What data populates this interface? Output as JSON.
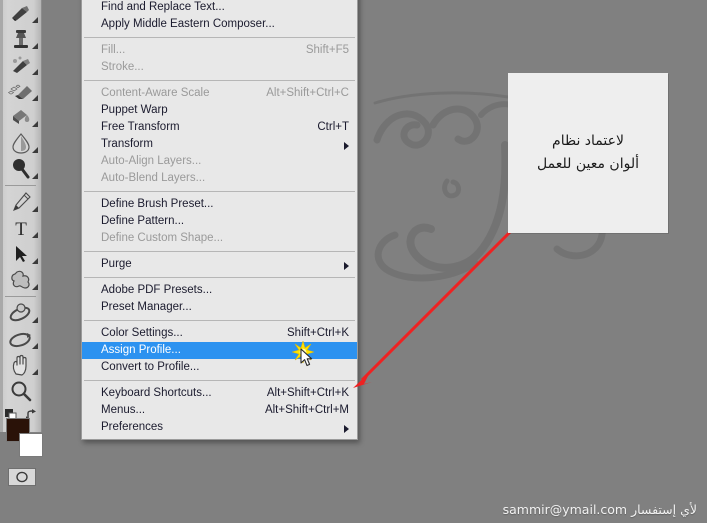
{
  "app": {
    "name": "Adobe Photoshop",
    "background_color": "#808080",
    "accent_highlight": "#2c92f0",
    "menu_background": "#f0f0f0"
  },
  "toolbar": {
    "name": "tools-panel",
    "foreground_color": "#2a1208",
    "background_color": "#ffffff",
    "tools": [
      {
        "icon": "brush-tool-icon",
        "label": "Brush Tool",
        "has_flyout": true
      },
      {
        "icon": "clone-stamp-tool-icon",
        "label": "Clone Stamp Tool",
        "has_flyout": true
      },
      {
        "icon": "history-brush-tool-icon",
        "label": "History Brush Tool",
        "has_flyout": true
      },
      {
        "icon": "eraser-tool-icon",
        "label": "Eraser Tool",
        "has_flyout": true
      },
      {
        "icon": "gradient-tool-icon",
        "label": "Paint Bucket Tool",
        "has_flyout": true
      },
      {
        "icon": "blur-tool-icon",
        "label": "Blur Tool",
        "has_flyout": true
      },
      {
        "icon": "dodge-tool-icon",
        "label": "Dodge Tool",
        "has_flyout": true
      },
      {
        "icon": "pen-tool-icon",
        "label": "Pen Tool",
        "has_flyout": true
      },
      {
        "icon": "type-tool-icon",
        "label": "Horizontal Type Tool",
        "has_flyout": true
      },
      {
        "icon": "path-selection-tool-icon",
        "label": "Path Selection Tool",
        "has_flyout": true
      },
      {
        "icon": "custom-shape-tool-icon",
        "label": "Custom Shape Tool",
        "has_flyout": true
      },
      {
        "icon": "3d-orbit-tool-icon",
        "label": "3D Orbit Tool",
        "has_flyout": true
      },
      {
        "icon": "3d-rotate-tool-icon",
        "label": "3D Rotate Tool",
        "has_flyout": true
      },
      {
        "icon": "hand-tool-icon",
        "label": "Hand Tool",
        "has_flyout": true
      },
      {
        "icon": "zoom-tool-icon",
        "label": "Zoom Tool",
        "has_flyout": false
      }
    ],
    "swatch_controls": {
      "default_colors_icon": "default-colors-icon",
      "swap_colors_icon": "swap-colors-icon",
      "quick_mask_icon": "quick-mask-icon"
    }
  },
  "menu": {
    "name": "edit-menu",
    "items": [
      {
        "label": "Find and Replace Text...",
        "shortcut": "",
        "state": "enabled",
        "submenu": false
      },
      {
        "label": "Apply Middle Eastern Composer...",
        "shortcut": "",
        "state": "enabled",
        "submenu": false
      },
      {
        "type": "separator"
      },
      {
        "label": "Fill...",
        "shortcut": "Shift+F5",
        "state": "disabled",
        "submenu": false
      },
      {
        "label": "Stroke...",
        "shortcut": "",
        "state": "disabled",
        "submenu": false
      },
      {
        "type": "separator"
      },
      {
        "label": "Content-Aware Scale",
        "shortcut": "Alt+Shift+Ctrl+C",
        "state": "disabled",
        "submenu": false
      },
      {
        "label": "Puppet Warp",
        "shortcut": "",
        "state": "enabled",
        "submenu": false
      },
      {
        "label": "Free Transform",
        "shortcut": "Ctrl+T",
        "state": "enabled",
        "submenu": false
      },
      {
        "label": "Transform",
        "shortcut": "",
        "state": "enabled",
        "submenu": true
      },
      {
        "label": "Auto-Align Layers...",
        "shortcut": "",
        "state": "disabled",
        "submenu": false
      },
      {
        "label": "Auto-Blend Layers...",
        "shortcut": "",
        "state": "disabled",
        "submenu": false
      },
      {
        "type": "separator"
      },
      {
        "label": "Define Brush Preset...",
        "shortcut": "",
        "state": "enabled",
        "submenu": false
      },
      {
        "label": "Define Pattern...",
        "shortcut": "",
        "state": "enabled",
        "submenu": false
      },
      {
        "label": "Define Custom Shape...",
        "shortcut": "",
        "state": "disabled",
        "submenu": false
      },
      {
        "type": "separator"
      },
      {
        "label": "Purge",
        "shortcut": "",
        "state": "enabled",
        "submenu": true
      },
      {
        "type": "separator"
      },
      {
        "label": "Adobe PDF Presets...",
        "shortcut": "",
        "state": "enabled",
        "submenu": false
      },
      {
        "label": "Preset Manager...",
        "shortcut": "",
        "state": "enabled",
        "submenu": false
      },
      {
        "type": "separator"
      },
      {
        "label": "Color Settings...",
        "shortcut": "Shift+Ctrl+K",
        "state": "enabled",
        "submenu": false
      },
      {
        "label": "Assign Profile...",
        "shortcut": "",
        "state": "selected",
        "submenu": false
      },
      {
        "label": "Convert to Profile...",
        "shortcut": "",
        "state": "enabled",
        "submenu": false
      },
      {
        "type": "separator"
      },
      {
        "label": "Keyboard Shortcuts...",
        "shortcut": "Alt+Shift+Ctrl+K",
        "state": "enabled",
        "submenu": false
      },
      {
        "label": "Menus...",
        "shortcut": "Alt+Shift+Ctrl+M",
        "state": "enabled",
        "submenu": false
      },
      {
        "label": "Preferences",
        "shortcut": "",
        "state": "enabled",
        "submenu": true
      }
    ]
  },
  "note": {
    "name": "annotation-note",
    "lines": [
      "لاعتماد نظام",
      "ألوان معين للعمل"
    ],
    "background_color": "#eeeeee"
  },
  "annotation": {
    "arrow_color": "#ee2222",
    "points_from": "annotation-note",
    "points_to": "Assign Profile..."
  },
  "cursor": {
    "icon": "arrow-cursor-with-sparkle",
    "sparkle_color": "#ffe400"
  },
  "credit": {
    "text": "لأي إستفسار sammir@ymail.com"
  }
}
